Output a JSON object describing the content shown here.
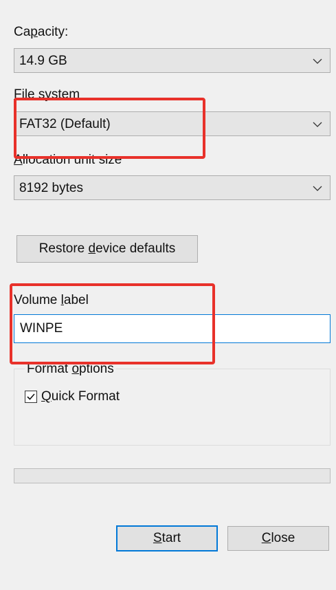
{
  "capacity": {
    "label_pre": "Ca",
    "label_ul": "p",
    "label_post": "acity:",
    "value": "14.9 GB"
  },
  "file_system": {
    "label_ul": "F",
    "label_post": "ile system",
    "value": "FAT32 (Default)"
  },
  "allocation": {
    "label_ul": "A",
    "label_post": "llocation unit size",
    "value": "8192 bytes"
  },
  "restore_button": {
    "label_pre": "Restore ",
    "label_ul": "d",
    "label_post": "evice defaults"
  },
  "volume_label": {
    "label_pre": "Volume ",
    "label_ul": "l",
    "label_post": "abel",
    "value": "WINPE"
  },
  "format_options": {
    "legend_pre": "Format ",
    "legend_ul": "o",
    "legend_post": "ptions",
    "quick_format": {
      "label_ul": "Q",
      "label_post": "uick Format",
      "checked": true
    }
  },
  "progress": {
    "value": 0
  },
  "buttons": {
    "start": {
      "label_ul": "S",
      "label_post": "tart"
    },
    "close": {
      "label_ul": "C",
      "label_post": "lose"
    }
  },
  "icons": {
    "dropdown": "chevron-down-icon",
    "check": "checkmark-icon"
  },
  "colors": {
    "highlight": "#e8312a",
    "focus": "#0078d7"
  }
}
